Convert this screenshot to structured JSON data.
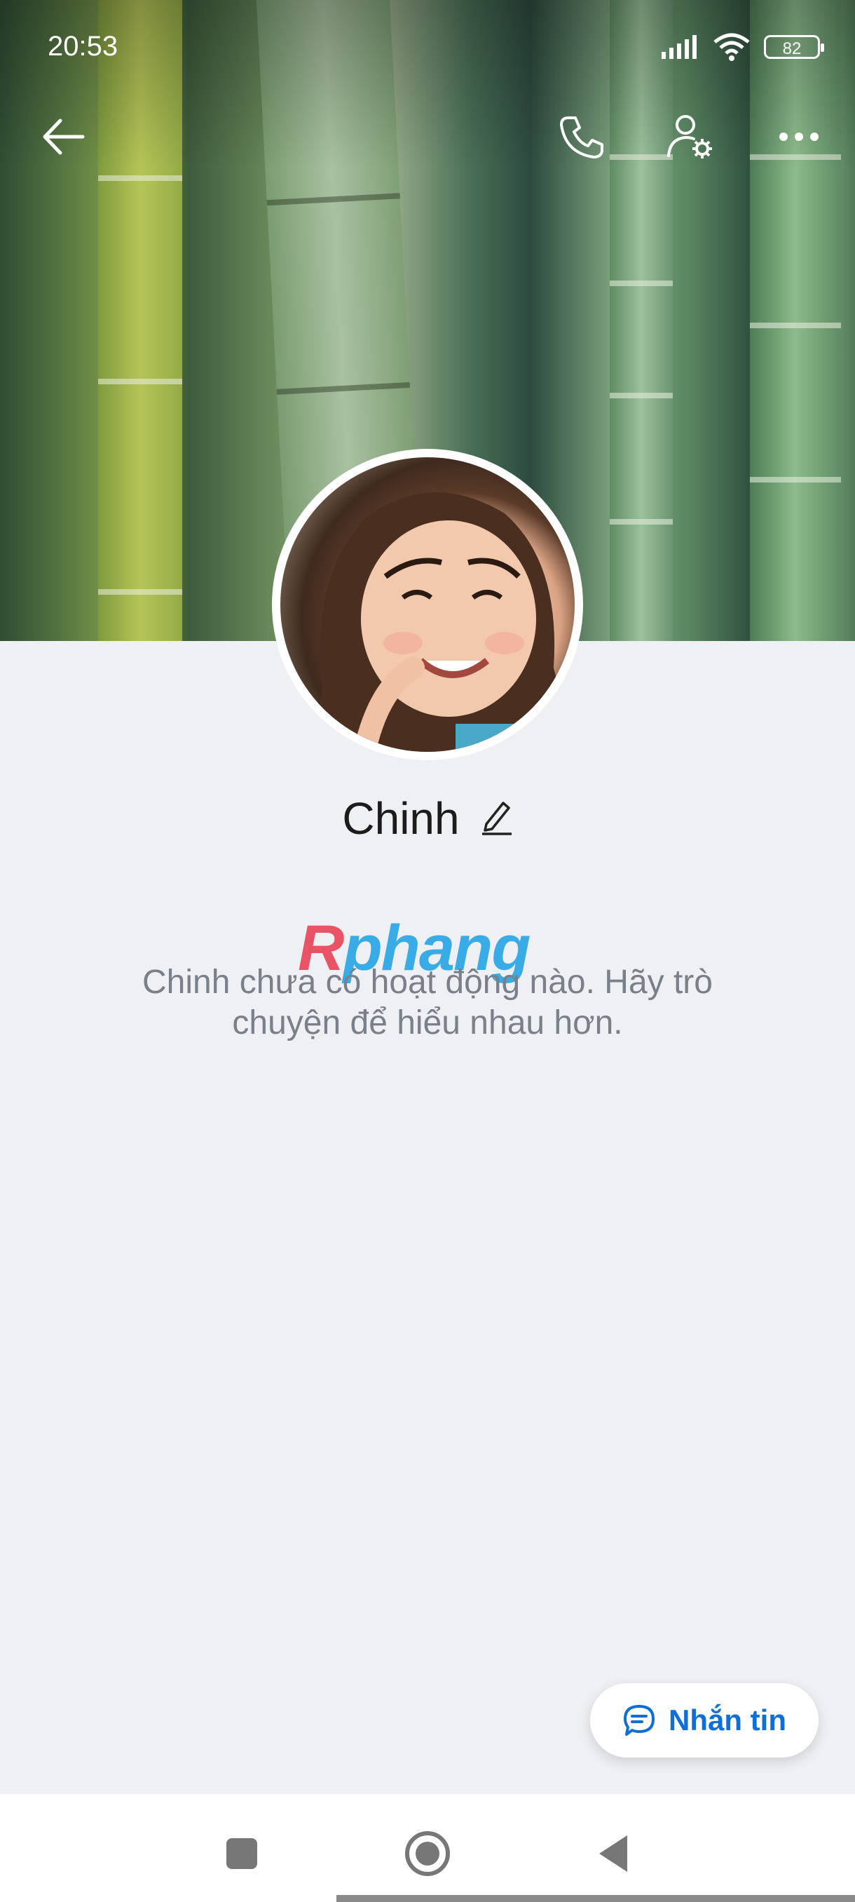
{
  "status_bar": {
    "time": "20:53",
    "battery": "82"
  },
  "profile": {
    "name": "Chinh",
    "empty_message": "Chinh chưa có hoạt động nào. Hãy trò chuyện để hiểu nhau hơn."
  },
  "watermark": {
    "part1": "R",
    "part2": "phang"
  },
  "fab": {
    "label": "Nhắn tin"
  },
  "icons": {
    "back": "back-arrow-icon",
    "call": "phone-icon",
    "settings": "user-settings-icon",
    "more": "more-icon",
    "edit": "pencil-icon",
    "message": "chat-bubble-icon"
  },
  "colors": {
    "accent": "#0f6fd7",
    "background": "#eff0f4",
    "text_muted": "#7a808a"
  }
}
